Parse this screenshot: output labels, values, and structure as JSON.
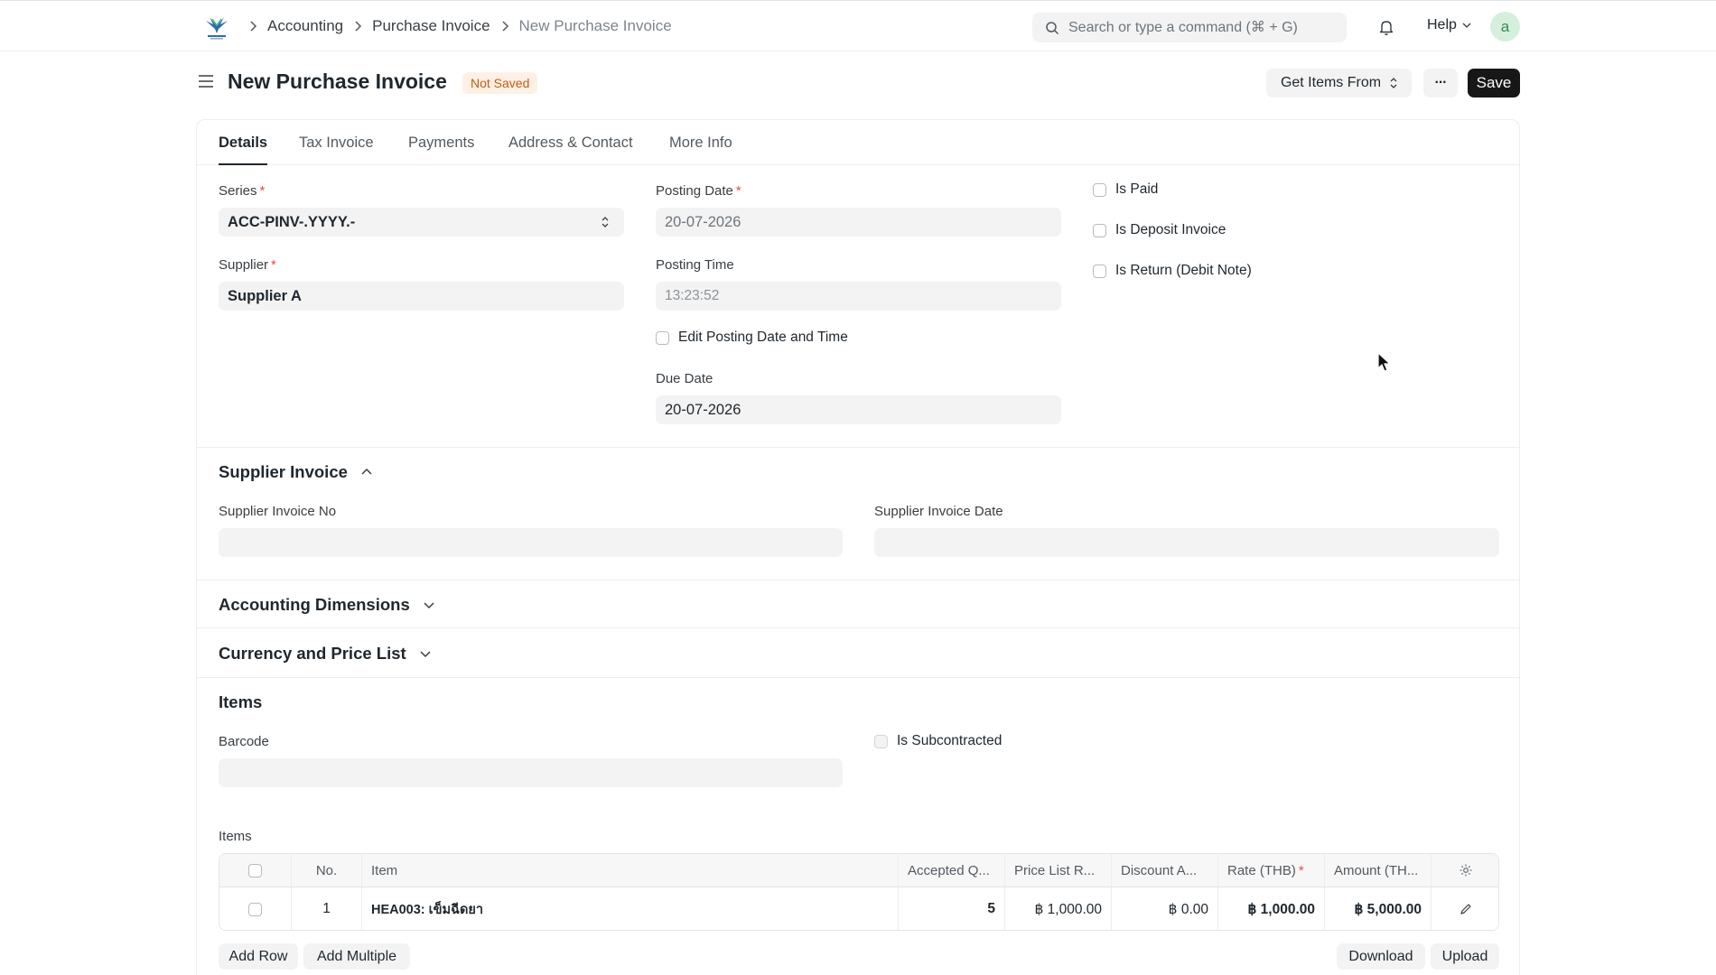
{
  "navbar": {
    "breadcrumbs": [
      "Accounting",
      "Purchase Invoice",
      "New Purchase Invoice"
    ],
    "search_placeholder": "Search or type a command (⌘ + G)",
    "help_label": "Help",
    "avatar_letter": "a"
  },
  "page": {
    "title": "New Purchase Invoice",
    "status_badge": "Not Saved",
    "get_items_label": "Get Items From",
    "more_label": "···",
    "save_label": "Save"
  },
  "tabs": [
    "Details",
    "Tax Invoice",
    "Payments",
    "Address & Contact",
    "More Info"
  ],
  "details": {
    "series_label": "Series",
    "series_value": "ACC-PINV-.YYYY.-",
    "supplier_label": "Supplier",
    "supplier_value": "Supplier A",
    "posting_date_label": "Posting Date",
    "posting_date_value": "20-07-2026",
    "posting_time_label": "Posting Time",
    "posting_time_value": "13:23:52",
    "edit_posting_label": "Edit Posting Date and Time",
    "due_date_label": "Due Date",
    "due_date_value": "20-07-2026",
    "is_paid_label": "Is Paid",
    "is_deposit_label": "Is Deposit Invoice",
    "is_return_label": "Is Return (Debit Note)"
  },
  "supplier_invoice": {
    "title": "Supplier Invoice",
    "no_label": "Supplier Invoice No",
    "no_value": "",
    "date_label": "Supplier Invoice Date",
    "date_value": ""
  },
  "sections": {
    "accounting_dimensions": "Accounting Dimensions",
    "currency_price_list": "Currency and Price List",
    "items": "Items"
  },
  "items_section": {
    "barcode_label": "Barcode",
    "barcode_value": "",
    "is_subcontracted_label": "Is Subcontracted",
    "table_label": "Items"
  },
  "items_table": {
    "headers": {
      "no": "No.",
      "item": "Item",
      "accepted_qty": "Accepted Q...",
      "price_list_rate": "Price List R...",
      "discount": "Discount A...",
      "rate": "Rate (THB)",
      "amount": "Amount (TH..."
    },
    "rows": [
      {
        "no": "1",
        "item": "HEA003: เข็มฉีดยา",
        "accepted_qty": "5",
        "price_list_rate": "฿ 1,000.00",
        "discount": "฿ 0.00",
        "rate": "฿ 1,000.00",
        "amount": "฿ 5,000.00"
      }
    ]
  },
  "table_buttons": {
    "add_row": "Add Row",
    "add_multiple": "Add Multiple",
    "download": "Download",
    "upload": "Upload"
  }
}
